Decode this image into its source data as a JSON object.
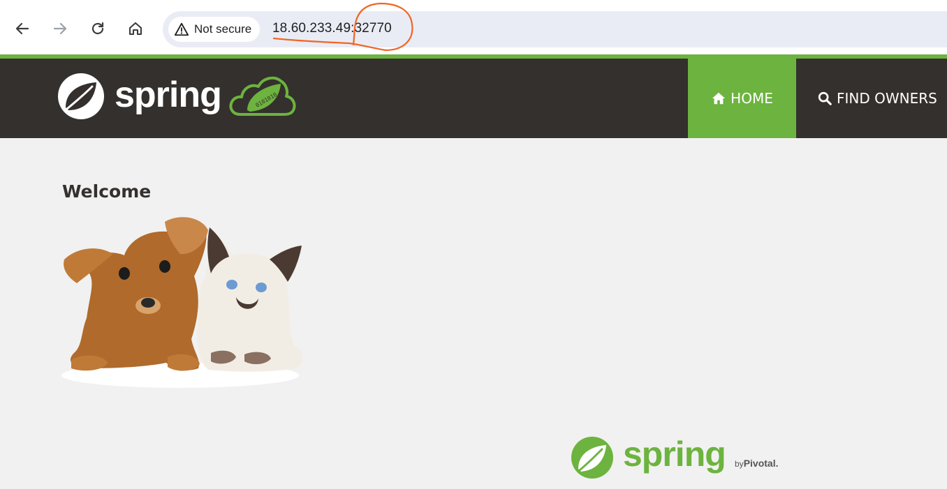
{
  "browser": {
    "back_icon": "arrow-left-icon",
    "forward_icon": "arrow-right-icon",
    "reload_icon": "reload-icon",
    "home_icon": "home-icon",
    "security_icon": "warning-triangle-icon",
    "security_label": "Not secure",
    "url": "18.60.233.49:32770",
    "annotation_color": "#f26522"
  },
  "app": {
    "brand": "spring",
    "brand_cloud_digits": "0101010",
    "accent_color": "#6db33f",
    "navbar_color": "#34302d",
    "nav": [
      {
        "label": "HOME",
        "icon": "home-icon",
        "active": true
      },
      {
        "label": "FIND OWNERS",
        "icon": "search-icon",
        "active": false
      }
    ]
  },
  "main": {
    "heading": "Welcome",
    "image_alt": "puppy and kitten"
  },
  "footer": {
    "brand": "spring",
    "by": "by",
    "company": "Pivotal."
  }
}
